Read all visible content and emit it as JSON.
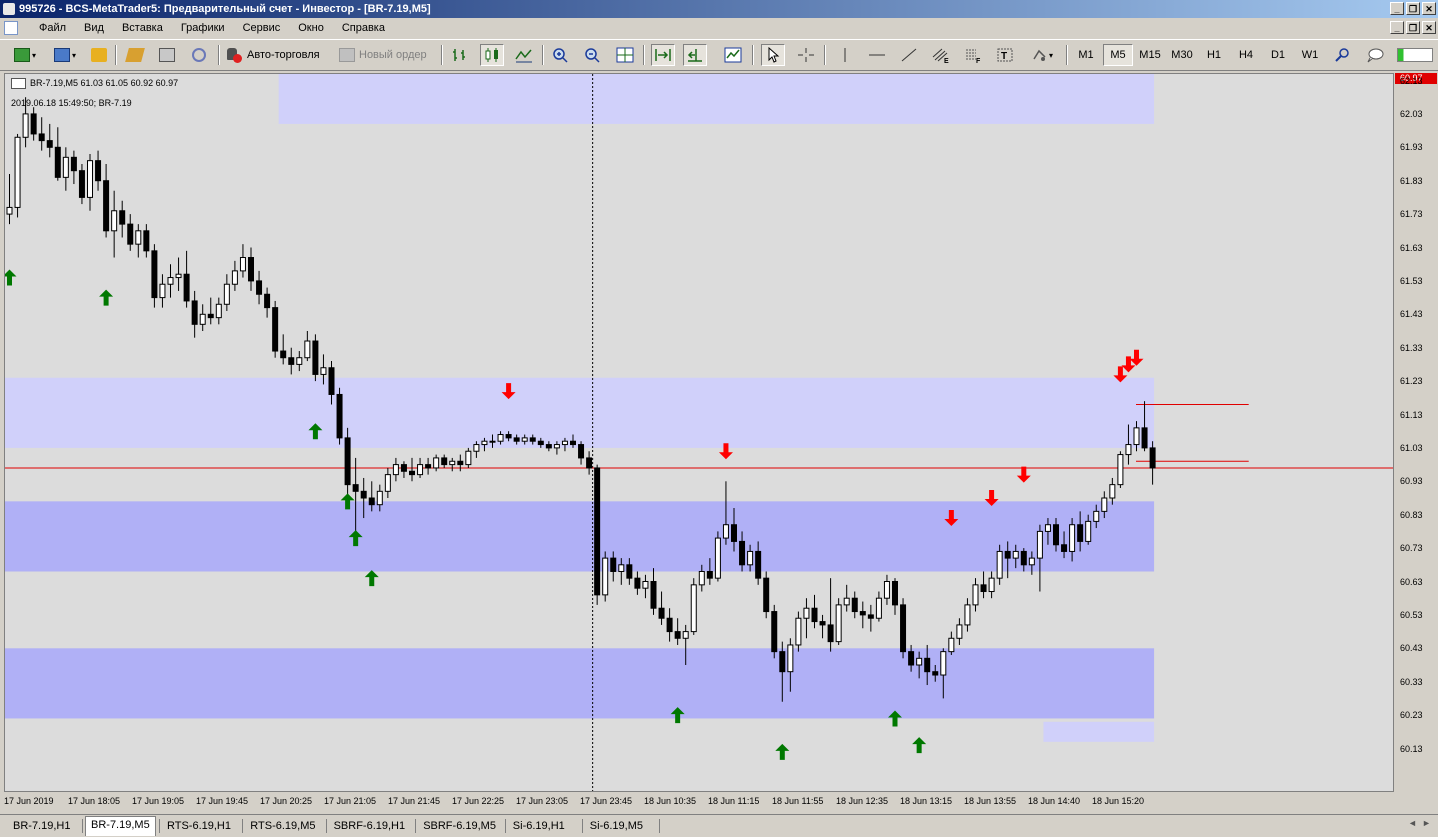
{
  "window": {
    "title": "995726 - BCS-MetaTrader5: Предварительный счет - Инвестор - [BR-7.19,M5]",
    "controls": [
      "_",
      "❐",
      "✕"
    ],
    "mdi_controls": [
      "_",
      "❐",
      "✕"
    ]
  },
  "menu": [
    "Файл",
    "Вид",
    "Вставка",
    "Графики",
    "Сервис",
    "Окно",
    "Справка"
  ],
  "toolbar": {
    "autotrade_label": "Авто-торговля",
    "new_order_label": "Новый ордер",
    "timeframes": [
      "M1",
      "M5",
      "M15",
      "M30",
      "H1",
      "H4",
      "D1",
      "W1"
    ],
    "active_timeframe": "M5"
  },
  "chart": {
    "symbol_line": "BR-7.19,M5  61.03 61.05 60.92 60.97",
    "sub_line": "2019.06.18 15:49:50; BR-7.19",
    "current_price_label": "60.97",
    "price_labels": [
      "62.13",
      "62.03",
      "61.93",
      "61.83",
      "61.73",
      "61.63",
      "61.53",
      "61.43",
      "61.33",
      "61.23",
      "61.13",
      "61.03",
      "60.93",
      "60.83",
      "60.73",
      "60.63",
      "60.53",
      "60.43",
      "60.33",
      "60.23",
      "60.13"
    ],
    "time_labels": [
      "17 Jun 2019",
      "17 Jun 18:05",
      "17 Jun 19:05",
      "17 Jun 19:45",
      "17 Jun 20:25",
      "17 Jun 21:05",
      "17 Jun 21:45",
      "17 Jun 22:25",
      "17 Jun 23:05",
      "17 Jun 23:45",
      "18 Jun 10:35",
      "18 Jun 11:15",
      "18 Jun 11:55",
      "18 Jun 12:35",
      "18 Jun 13:15",
      "18 Jun 13:55",
      "18 Jun 14:40",
      "18 Jun 15:20"
    ],
    "colors": {
      "background": "#dcdcdc",
      "zone_light": "#d0d0fa",
      "zone_mid": "#b0b0f6",
      "up_arrow": "#007800",
      "down_arrow": "#ff0000",
      "price_line": "#e00000"
    }
  },
  "chart_data": {
    "type": "candlestick",
    "symbol": "BR-7.19",
    "timeframe": "M5",
    "ylim": [
      60.08,
      62.15
    ],
    "last": {
      "open": 61.03,
      "high": 61.05,
      "low": 60.92,
      "close": 60.97
    },
    "zones": [
      {
        "x_from": 34,
        "x_to": 142,
        "y_from": 62.0,
        "y_to": 62.15,
        "color": "light"
      },
      {
        "x_from": 0,
        "x_to": 142,
        "y_from": 61.03,
        "y_to": 61.24,
        "color": "light"
      },
      {
        "x_from": 0,
        "x_to": 142,
        "y_from": 60.66,
        "y_to": 60.87,
        "color": "mid"
      },
      {
        "x_from": 0,
        "x_to": 142,
        "y_from": 60.22,
        "y_to": 60.43,
        "color": "mid"
      },
      {
        "x_from": 129,
        "x_to": 142,
        "y_from": 60.15,
        "y_to": 60.21,
        "color": "light"
      }
    ],
    "session_separator_index": 73,
    "h_lines": [
      {
        "price": 60.97,
        "color": "#e00000",
        "full_width": true
      },
      {
        "price": 61.16,
        "color": "#e00000",
        "x_from": 140,
        "x_to": 154
      },
      {
        "price": 60.99,
        "color": "#e00000",
        "x_from": 140,
        "x_to": 154
      }
    ],
    "candles": [
      {
        "o": 61.73,
        "h": 61.85,
        "l": 61.7,
        "c": 61.75
      },
      {
        "o": 61.75,
        "h": 61.97,
        "l": 61.72,
        "c": 61.96
      },
      {
        "o": 61.96,
        "h": 62.08,
        "l": 61.93,
        "c": 62.03
      },
      {
        "o": 62.03,
        "h": 62.05,
        "l": 61.95,
        "c": 61.97
      },
      {
        "o": 61.97,
        "h": 62.02,
        "l": 61.92,
        "c": 61.95
      },
      {
        "o": 61.95,
        "h": 62.0,
        "l": 61.9,
        "c": 61.93
      },
      {
        "o": 61.93,
        "h": 61.99,
        "l": 61.83,
        "c": 61.84
      },
      {
        "o": 61.84,
        "h": 61.93,
        "l": 61.8,
        "c": 61.9
      },
      {
        "o": 61.9,
        "h": 61.92,
        "l": 61.82,
        "c": 61.86
      },
      {
        "o": 61.86,
        "h": 61.88,
        "l": 61.76,
        "c": 61.78
      },
      {
        "o": 61.78,
        "h": 61.91,
        "l": 61.74,
        "c": 61.89
      },
      {
        "o": 61.89,
        "h": 61.92,
        "l": 61.8,
        "c": 61.83
      },
      {
        "o": 61.83,
        "h": 61.88,
        "l": 61.66,
        "c": 61.68
      },
      {
        "o": 61.68,
        "h": 61.8,
        "l": 61.6,
        "c": 61.74
      },
      {
        "o": 61.74,
        "h": 61.77,
        "l": 61.66,
        "c": 61.7
      },
      {
        "o": 61.7,
        "h": 61.73,
        "l": 61.62,
        "c": 61.64
      },
      {
        "o": 61.64,
        "h": 61.7,
        "l": 61.6,
        "c": 61.68
      },
      {
        "o": 61.68,
        "h": 61.7,
        "l": 61.6,
        "c": 61.62
      },
      {
        "o": 61.62,
        "h": 61.64,
        "l": 61.45,
        "c": 61.48
      },
      {
        "o": 61.48,
        "h": 61.55,
        "l": 61.45,
        "c": 61.52
      },
      {
        "o": 61.52,
        "h": 61.58,
        "l": 61.48,
        "c": 61.54
      },
      {
        "o": 61.54,
        "h": 61.6,
        "l": 61.5,
        "c": 61.55
      },
      {
        "o": 61.55,
        "h": 61.62,
        "l": 61.45,
        "c": 61.47
      },
      {
        "o": 61.47,
        "h": 61.5,
        "l": 61.36,
        "c": 61.4
      },
      {
        "o": 61.4,
        "h": 61.46,
        "l": 61.38,
        "c": 61.43
      },
      {
        "o": 61.43,
        "h": 61.48,
        "l": 61.4,
        "c": 61.42
      },
      {
        "o": 61.42,
        "h": 61.48,
        "l": 61.4,
        "c": 61.46
      },
      {
        "o": 61.46,
        "h": 61.55,
        "l": 61.44,
        "c": 61.52
      },
      {
        "o": 61.52,
        "h": 61.59,
        "l": 61.5,
        "c": 61.56
      },
      {
        "o": 61.56,
        "h": 61.64,
        "l": 61.54,
        "c": 61.6
      },
      {
        "o": 61.6,
        "h": 61.63,
        "l": 61.5,
        "c": 61.53
      },
      {
        "o": 61.53,
        "h": 61.56,
        "l": 61.46,
        "c": 61.49
      },
      {
        "o": 61.49,
        "h": 61.51,
        "l": 61.42,
        "c": 61.45
      },
      {
        "o": 61.45,
        "h": 61.47,
        "l": 61.3,
        "c": 61.32
      },
      {
        "o": 61.32,
        "h": 61.37,
        "l": 61.28,
        "c": 61.3
      },
      {
        "o": 61.3,
        "h": 61.33,
        "l": 61.25,
        "c": 61.28
      },
      {
        "o": 61.28,
        "h": 61.32,
        "l": 61.26,
        "c": 61.3
      },
      {
        "o": 61.3,
        "h": 61.38,
        "l": 61.29,
        "c": 61.35
      },
      {
        "o": 61.35,
        "h": 61.37,
        "l": 61.23,
        "c": 61.25
      },
      {
        "o": 61.25,
        "h": 61.31,
        "l": 61.22,
        "c": 61.27
      },
      {
        "o": 61.27,
        "h": 61.29,
        "l": 61.16,
        "c": 61.19
      },
      {
        "o": 61.19,
        "h": 61.21,
        "l": 61.04,
        "c": 61.06
      },
      {
        "o": 61.06,
        "h": 61.09,
        "l": 60.88,
        "c": 60.92
      },
      {
        "o": 60.92,
        "h": 61.0,
        "l": 60.78,
        "c": 60.9
      },
      {
        "o": 60.9,
        "h": 60.94,
        "l": 60.82,
        "c": 60.88
      },
      {
        "o": 60.88,
        "h": 60.93,
        "l": 60.84,
        "c": 60.86
      },
      {
        "o": 60.86,
        "h": 60.92,
        "l": 60.84,
        "c": 60.9
      },
      {
        "o": 60.9,
        "h": 60.97,
        "l": 60.88,
        "c": 60.95
      },
      {
        "o": 60.95,
        "h": 61.0,
        "l": 60.93,
        "c": 60.98
      },
      {
        "o": 60.98,
        "h": 60.99,
        "l": 60.94,
        "c": 60.96
      },
      {
        "o": 60.96,
        "h": 61.0,
        "l": 60.93,
        "c": 60.95
      },
      {
        "o": 60.95,
        "h": 61.0,
        "l": 60.94,
        "c": 60.98
      },
      {
        "o": 60.98,
        "h": 61.0,
        "l": 60.95,
        "c": 60.97
      },
      {
        "o": 60.97,
        "h": 61.01,
        "l": 60.96,
        "c": 61.0
      },
      {
        "o": 61.0,
        "h": 61.01,
        "l": 60.97,
        "c": 60.98
      },
      {
        "o": 60.98,
        "h": 61.0,
        "l": 60.96,
        "c": 60.99
      },
      {
        "o": 60.99,
        "h": 61.01,
        "l": 60.96,
        "c": 60.98
      },
      {
        "o": 60.98,
        "h": 61.03,
        "l": 60.97,
        "c": 61.02
      },
      {
        "o": 61.02,
        "h": 61.05,
        "l": 61.0,
        "c": 61.04
      },
      {
        "o": 61.04,
        "h": 61.06,
        "l": 61.02,
        "c": 61.05
      },
      {
        "o": 61.05,
        "h": 61.07,
        "l": 61.03,
        "c": 61.05
      },
      {
        "o": 61.05,
        "h": 61.08,
        "l": 61.04,
        "c": 61.07
      },
      {
        "o": 61.07,
        "h": 61.08,
        "l": 61.05,
        "c": 61.06
      },
      {
        "o": 61.06,
        "h": 61.07,
        "l": 61.04,
        "c": 61.05
      },
      {
        "o": 61.05,
        "h": 61.07,
        "l": 61.04,
        "c": 61.06
      },
      {
        "o": 61.06,
        "h": 61.07,
        "l": 61.04,
        "c": 61.05
      },
      {
        "o": 61.05,
        "h": 61.06,
        "l": 61.03,
        "c": 61.04
      },
      {
        "o": 61.04,
        "h": 61.05,
        "l": 61.02,
        "c": 61.03
      },
      {
        "o": 61.03,
        "h": 61.05,
        "l": 61.01,
        "c": 61.04
      },
      {
        "o": 61.04,
        "h": 61.06,
        "l": 61.02,
        "c": 61.05
      },
      {
        "o": 61.05,
        "h": 61.07,
        "l": 61.03,
        "c": 61.04
      },
      {
        "o": 61.04,
        "h": 61.05,
        "l": 60.98,
        "c": 61.0
      },
      {
        "o": 61.0,
        "h": 61.02,
        "l": 60.95,
        "c": 60.97
      },
      {
        "o": 60.97,
        "h": 60.98,
        "l": 60.56,
        "c": 60.59
      },
      {
        "o": 60.59,
        "h": 60.72,
        "l": 60.57,
        "c": 60.7
      },
      {
        "o": 60.7,
        "h": 60.72,
        "l": 60.63,
        "c": 60.66
      },
      {
        "o": 60.66,
        "h": 60.7,
        "l": 60.62,
        "c": 60.68
      },
      {
        "o": 60.68,
        "h": 60.7,
        "l": 60.62,
        "c": 60.64
      },
      {
        "o": 60.64,
        "h": 60.66,
        "l": 60.59,
        "c": 60.61
      },
      {
        "o": 60.61,
        "h": 60.65,
        "l": 60.58,
        "c": 60.63
      },
      {
        "o": 60.63,
        "h": 60.67,
        "l": 60.53,
        "c": 60.55
      },
      {
        "o": 60.55,
        "h": 60.6,
        "l": 60.5,
        "c": 60.52
      },
      {
        "o": 60.52,
        "h": 60.55,
        "l": 60.45,
        "c": 60.48
      },
      {
        "o": 60.48,
        "h": 60.52,
        "l": 60.44,
        "c": 60.46
      },
      {
        "o": 60.46,
        "h": 60.5,
        "l": 60.38,
        "c": 60.48
      },
      {
        "o": 60.48,
        "h": 60.64,
        "l": 60.47,
        "c": 60.62
      },
      {
        "o": 60.62,
        "h": 60.68,
        "l": 60.6,
        "c": 60.66
      },
      {
        "o": 60.66,
        "h": 60.7,
        "l": 60.62,
        "c": 60.64
      },
      {
        "o": 60.64,
        "h": 60.78,
        "l": 60.63,
        "c": 60.76
      },
      {
        "o": 60.76,
        "h": 60.93,
        "l": 60.74,
        "c": 60.8
      },
      {
        "o": 60.8,
        "h": 60.85,
        "l": 60.72,
        "c": 60.75
      },
      {
        "o": 60.75,
        "h": 60.78,
        "l": 60.66,
        "c": 60.68
      },
      {
        "o": 60.68,
        "h": 60.74,
        "l": 60.66,
        "c": 60.72
      },
      {
        "o": 60.72,
        "h": 60.75,
        "l": 60.62,
        "c": 60.64
      },
      {
        "o": 60.64,
        "h": 60.66,
        "l": 60.52,
        "c": 60.54
      },
      {
        "o": 60.54,
        "h": 60.56,
        "l": 60.4,
        "c": 60.42
      },
      {
        "o": 60.42,
        "h": 60.45,
        "l": 60.27,
        "c": 60.36
      },
      {
        "o": 60.36,
        "h": 60.46,
        "l": 60.3,
        "c": 60.44
      },
      {
        "o": 60.44,
        "h": 60.54,
        "l": 60.42,
        "c": 60.52
      },
      {
        "o": 60.52,
        "h": 60.58,
        "l": 60.46,
        "c": 60.55
      },
      {
        "o": 60.55,
        "h": 60.59,
        "l": 60.49,
        "c": 60.51
      },
      {
        "o": 60.51,
        "h": 60.53,
        "l": 60.46,
        "c": 60.5
      },
      {
        "o": 60.5,
        "h": 60.64,
        "l": 60.42,
        "c": 60.45
      },
      {
        "o": 60.45,
        "h": 60.58,
        "l": 60.44,
        "c": 60.56
      },
      {
        "o": 60.56,
        "h": 60.62,
        "l": 60.54,
        "c": 60.58
      },
      {
        "o": 60.58,
        "h": 60.6,
        "l": 60.52,
        "c": 60.54
      },
      {
        "o": 60.54,
        "h": 60.57,
        "l": 60.49,
        "c": 60.53
      },
      {
        "o": 60.53,
        "h": 60.56,
        "l": 60.48,
        "c": 60.52
      },
      {
        "o": 60.52,
        "h": 60.6,
        "l": 60.51,
        "c": 60.58
      },
      {
        "o": 60.58,
        "h": 60.65,
        "l": 60.56,
        "c": 60.63
      },
      {
        "o": 60.63,
        "h": 60.64,
        "l": 60.53,
        "c": 60.56
      },
      {
        "o": 60.56,
        "h": 60.58,
        "l": 60.4,
        "c": 60.42
      },
      {
        "o": 60.42,
        "h": 60.44,
        "l": 60.36,
        "c": 60.38
      },
      {
        "o": 60.38,
        "h": 60.42,
        "l": 60.34,
        "c": 60.4
      },
      {
        "o": 60.4,
        "h": 60.44,
        "l": 60.32,
        "c": 60.36
      },
      {
        "o": 60.36,
        "h": 60.38,
        "l": 60.33,
        "c": 60.35
      },
      {
        "o": 60.35,
        "h": 60.43,
        "l": 60.28,
        "c": 60.42
      },
      {
        "o": 60.42,
        "h": 60.48,
        "l": 60.41,
        "c": 60.46
      },
      {
        "o": 60.46,
        "h": 60.52,
        "l": 60.44,
        "c": 60.5
      },
      {
        "o": 60.5,
        "h": 60.58,
        "l": 60.48,
        "c": 60.56
      },
      {
        "o": 60.56,
        "h": 60.64,
        "l": 60.54,
        "c": 60.62
      },
      {
        "o": 60.62,
        "h": 60.66,
        "l": 60.58,
        "c": 60.6
      },
      {
        "o": 60.6,
        "h": 60.66,
        "l": 60.58,
        "c": 60.64
      },
      {
        "o": 60.64,
        "h": 60.74,
        "l": 60.62,
        "c": 60.72
      },
      {
        "o": 60.72,
        "h": 60.75,
        "l": 60.64,
        "c": 60.7
      },
      {
        "o": 60.7,
        "h": 60.74,
        "l": 60.67,
        "c": 60.72
      },
      {
        "o": 60.72,
        "h": 60.73,
        "l": 60.66,
        "c": 60.68
      },
      {
        "o": 60.68,
        "h": 60.72,
        "l": 60.65,
        "c": 60.7
      },
      {
        "o": 60.7,
        "h": 60.8,
        "l": 60.6,
        "c": 60.78
      },
      {
        "o": 60.78,
        "h": 60.82,
        "l": 60.74,
        "c": 60.8
      },
      {
        "o": 60.8,
        "h": 60.82,
        "l": 60.72,
        "c": 60.74
      },
      {
        "o": 60.74,
        "h": 60.78,
        "l": 60.7,
        "c": 60.72
      },
      {
        "o": 60.72,
        "h": 60.82,
        "l": 60.69,
        "c": 60.8
      },
      {
        "o": 60.8,
        "h": 60.84,
        "l": 60.72,
        "c": 60.75
      },
      {
        "o": 60.75,
        "h": 60.83,
        "l": 60.74,
        "c": 60.81
      },
      {
        "o": 60.81,
        "h": 60.86,
        "l": 60.79,
        "c": 60.84
      },
      {
        "o": 60.84,
        "h": 60.9,
        "l": 60.82,
        "c": 60.88
      },
      {
        "o": 60.88,
        "h": 60.94,
        "l": 60.86,
        "c": 60.92
      },
      {
        "o": 60.92,
        "h": 61.02,
        "l": 60.91,
        "c": 61.01
      },
      {
        "o": 61.01,
        "h": 61.1,
        "l": 60.98,
        "c": 61.04
      },
      {
        "o": 61.04,
        "h": 61.11,
        "l": 61.02,
        "c": 61.09
      },
      {
        "o": 61.09,
        "h": 61.17,
        "l": 61.02,
        "c": 61.03
      },
      {
        "o": 61.03,
        "h": 61.05,
        "l": 60.92,
        "c": 60.97
      }
    ],
    "up_arrows": [
      {
        "index": 0,
        "price": 61.54
      },
      {
        "index": 12,
        "price": 61.48
      },
      {
        "index": 38,
        "price": 61.08
      },
      {
        "index": 42,
        "price": 60.87
      },
      {
        "index": 43,
        "price": 60.76
      },
      {
        "index": 45,
        "price": 60.64
      },
      {
        "index": 83,
        "price": 60.23
      },
      {
        "index": 96,
        "price": 60.12
      },
      {
        "index": 110,
        "price": 60.22
      },
      {
        "index": 113,
        "price": 60.14
      }
    ],
    "down_arrows": [
      {
        "index": 62,
        "price": 61.2
      },
      {
        "index": 89,
        "price": 61.02
      },
      {
        "index": 117,
        "price": 60.82
      },
      {
        "index": 122,
        "price": 60.88
      },
      {
        "index": 126,
        "price": 60.95
      },
      {
        "index": 138,
        "price": 61.25
      },
      {
        "index": 139,
        "price": 61.28
      },
      {
        "index": 140,
        "price": 61.3
      }
    ]
  },
  "tabs": [
    "BR-7.19,H1",
    "BR-7.19,M5",
    "RTS-6.19,H1",
    "RTS-6.19,M5",
    "SBRF-6.19,H1",
    "SBRF-6.19,M5",
    "Si-6.19,H1",
    "Si-6.19,M5"
  ],
  "active_tab": "BR-7.19,M5"
}
